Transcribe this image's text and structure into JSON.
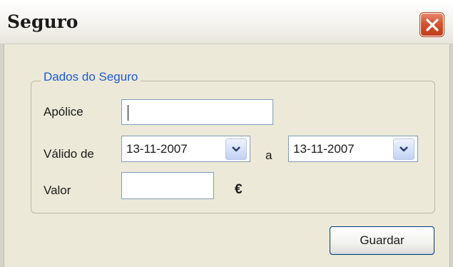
{
  "window": {
    "title": "Seguro"
  },
  "group": {
    "title": "Dados do Seguro"
  },
  "form": {
    "policy_label": "Apólice",
    "policy_value": "",
    "valid_from_label": "Válido de",
    "valid_from_value": "13-11-2007",
    "to_label": "a",
    "valid_to_value": "13-11-2007",
    "amount_label": "Valor",
    "amount_value": "",
    "currency_symbol": "€"
  },
  "buttons": {
    "save_label": "Guardar"
  },
  "icons": {
    "close": "close-icon",
    "dropdown": "chevron-down-icon"
  },
  "colors": {
    "group_title": "#1d5bd6",
    "close_button": "#d35431",
    "window_bg": "#ece9d8"
  }
}
